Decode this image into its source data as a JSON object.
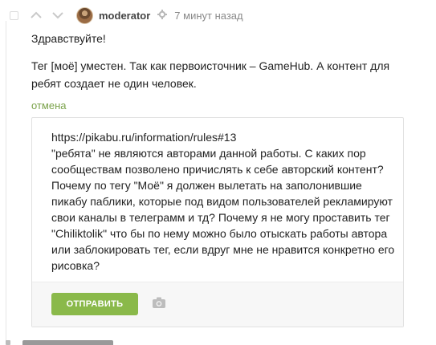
{
  "comment": {
    "username": "moderator",
    "time": "7 минут назад",
    "greeting": "Здравствуйте!",
    "body": "Тег [моё] уместен. Так как первоисточник – GameHub. А контент для ребят создает не один человек.",
    "cancel_label": "отмена"
  },
  "reply": {
    "text": "https://pikabu.ru/information/rules#13\n\"ребята\" не являются авторами данной работы. С каких пор сообществам позволено причислять к себе авторский контент? Почему по тегу \"Моё\" я должен вылетать на заполонившие пикабу паблики, которые под видом пользователей рекламируют свои каналы в телеграмм и тд? Почему я не могу проставить тег \"Chiliktolik\" что бы по нему можно было отыскать работы автора или заблокировать тег, если вдруг мне не нравится конкретно его рисовка?",
    "send_label": "ОТПРАВИТЬ"
  },
  "icons": {
    "collapse": "collapse-square-icon",
    "upvote": "chevron-up-icon",
    "downvote": "chevron-down-icon",
    "settings": "gear-icon",
    "camera": "camera-icon"
  },
  "colors": {
    "accent": "#8ab94a",
    "link": "#7aa24a"
  }
}
